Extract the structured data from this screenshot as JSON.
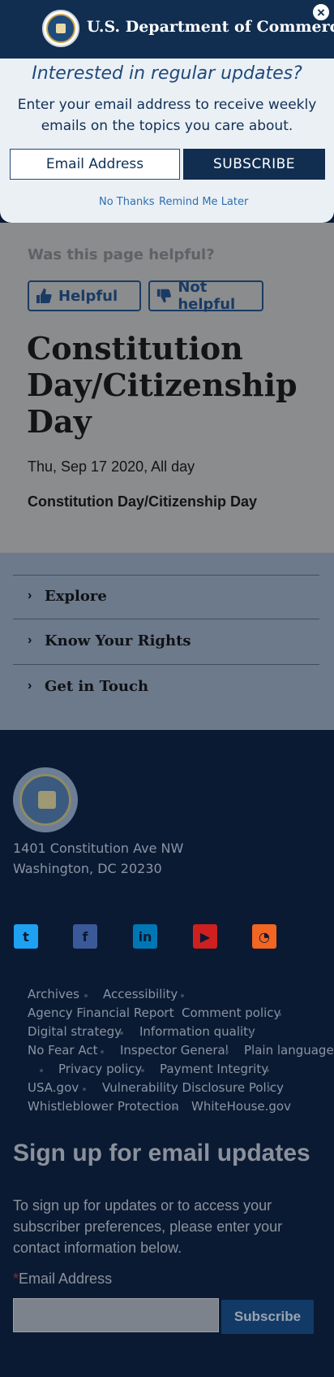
{
  "header": {
    "title": "U.S. Department of Commerce",
    "close_glyph": "×"
  },
  "popup": {
    "heading": "Interested in regular updates?",
    "text": "Enter your email address to receive weekly emails on the topics you care about.",
    "email_placeholder": "Email Address",
    "subscribe_label": "SUBSCRIBE",
    "no_thanks": "No Thanks",
    "remind_later": "Remind Me Later"
  },
  "feedback": {
    "question": "Was this page helpful?",
    "helpful": "Helpful",
    "not_helpful": "Not helpful"
  },
  "event": {
    "title": "Constitution Day/Citizenship Day",
    "date": "Thu, Sep 17 2020, All day",
    "name": "Constitution Day/Citizenship Day"
  },
  "accordion": {
    "items": [
      {
        "label": "Explore"
      },
      {
        "label": "Know Your Rights"
      },
      {
        "label": "Get in Touch"
      }
    ],
    "chevron": "›"
  },
  "footer": {
    "address_line1": "1401 Constitution Ave NW",
    "address_line2": "Washington, DC 20230",
    "social": [
      {
        "name": "twitter-icon",
        "glyph": "t",
        "color": "#1da1f2"
      },
      {
        "name": "facebook-icon",
        "glyph": "f",
        "color": "#3b5998"
      },
      {
        "name": "linkedin-icon",
        "glyph": "in",
        "color": "#0077b5"
      },
      {
        "name": "youtube-icon",
        "glyph": "▶",
        "color": "#cd201f"
      },
      {
        "name": "rss-icon",
        "glyph": "◔",
        "color": "#f26522"
      }
    ],
    "links": [
      "Archives",
      "Accessibility",
      "Agency Financial Report",
      "Comment policy",
      "Digital strategy",
      "Information quality",
      "No Fear Act",
      "Inspector General",
      "Plain language",
      "Privacy policy",
      "Payment Integrity",
      "USA.gov",
      "Vulnerability Disclosure Policy",
      "Whistleblower Protection",
      "WhiteHouse.gov"
    ]
  },
  "signup": {
    "heading": "Sign up for email updates",
    "text": "To sign up for updates or to access your subscriber preferences, please enter your contact information below.",
    "required_mark": "*",
    "email_label": "Email Address",
    "button": "Subscribe"
  }
}
